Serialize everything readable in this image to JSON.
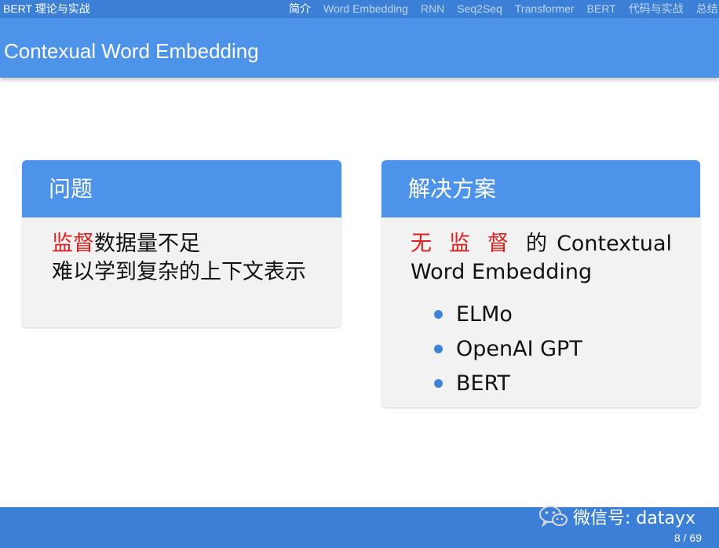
{
  "nav": {
    "deck_title": "BERT 理论与实战",
    "items": [
      {
        "label": "简介",
        "active": true
      },
      {
        "label": "Word Embedding",
        "active": false
      },
      {
        "label": "RNN",
        "active": false
      },
      {
        "label": "Seq2Seq",
        "active": false
      },
      {
        "label": "Transformer",
        "active": false
      },
      {
        "label": "BERT",
        "active": false
      },
      {
        "label": "代码与实战",
        "active": false
      },
      {
        "label": "总结",
        "active": false
      }
    ]
  },
  "slide": {
    "title": "Contexual Word Embedding"
  },
  "problem_block": {
    "header": "问题",
    "line1_highlight": "监督",
    "line1_rest": "数据量不足",
    "line2": "难以学到复杂的上下文表示"
  },
  "solution_block": {
    "header": "解决方案",
    "line1_highlight": "无监督",
    "line1_rest": "的",
    "line1_term": "Contextual",
    "line2": "Word Embedding",
    "bullets": [
      "ELMo",
      "OpenAI GPT",
      "BERT"
    ]
  },
  "footer": {
    "watermark": "微信号: datayx",
    "page_number": "8 / 69"
  },
  "colors": {
    "nav_bar": "#3c7fd6",
    "title_bar": "#4c93e9",
    "highlight_red": "#e02020",
    "bullet_dot": "#3f83d9"
  }
}
